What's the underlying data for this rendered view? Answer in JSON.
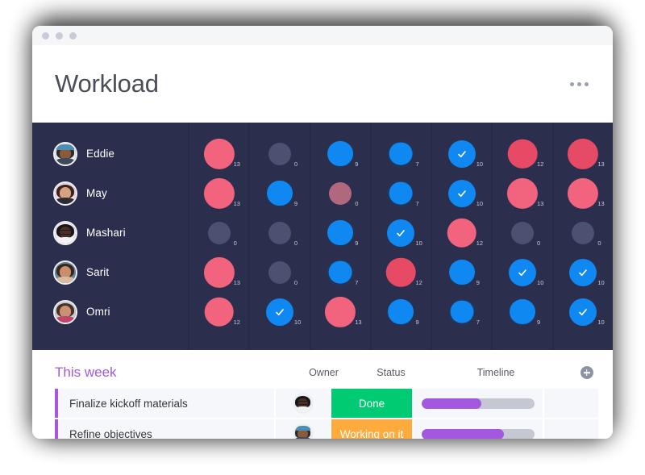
{
  "window": {
    "chrome_dots": [
      "dot-1",
      "dot-2",
      "dot-3"
    ],
    "title": "Workload",
    "menu_icon": "kebab-menu-icon"
  },
  "colors": {
    "grid_bg": "#2b2e4d",
    "grid_divider": "#272a47",
    "pink": "#f2637e",
    "red": "#e64a64",
    "mauve": "#b0687f",
    "blue": "#0f88f2",
    "blue_halo": "#243456",
    "gray": "#4d5070",
    "accent_purple": "#a358df",
    "done_green": "#00ca72",
    "working_orange": "#fdab3d",
    "track_gray": "#c5c8d3"
  },
  "workload": {
    "people": [
      {
        "name": "Eddie",
        "avatar": "avatar-eddie"
      },
      {
        "name": "May",
        "avatar": "avatar-may"
      },
      {
        "name": "Mashari",
        "avatar": "avatar-mashari"
      },
      {
        "name": "Sarit",
        "avatar": "avatar-sarit"
      },
      {
        "name": "Omri",
        "avatar": "avatar-omri"
      }
    ],
    "columns": [
      {
        "cells": [
          {
            "value": 13,
            "kind": "pink",
            "check": false
          },
          {
            "value": 13,
            "kind": "pink",
            "check": false
          },
          {
            "value": 0,
            "kind": "gray",
            "check": false
          },
          {
            "value": 13,
            "kind": "pink",
            "check": false
          },
          {
            "value": 12,
            "kind": "pink",
            "check": false
          }
        ]
      },
      {
        "cells": [
          {
            "value": 0,
            "kind": "gray",
            "check": false
          },
          {
            "value": 9,
            "kind": "blue",
            "check": false
          },
          {
            "value": 0,
            "kind": "gray",
            "check": false
          },
          {
            "value": 0,
            "kind": "gray",
            "check": false
          },
          {
            "value": 10,
            "kind": "blue",
            "check": true
          }
        ]
      },
      {
        "cells": [
          {
            "value": 9,
            "kind": "blue",
            "check": false
          },
          {
            "value": 0,
            "kind": "mauve",
            "check": false
          },
          {
            "value": 9,
            "kind": "blue",
            "check": false
          },
          {
            "value": 7,
            "kind": "blue",
            "check": false
          },
          {
            "value": 13,
            "kind": "pink",
            "check": false
          }
        ]
      },
      {
        "cells": [
          {
            "value": 7,
            "kind": "blue",
            "check": false
          },
          {
            "value": 7,
            "kind": "blue",
            "check": false
          },
          {
            "value": 10,
            "kind": "blue",
            "check": true
          },
          {
            "value": 12,
            "kind": "red",
            "check": false
          },
          {
            "value": 9,
            "kind": "blue",
            "check": false
          }
        ]
      },
      {
        "cells": [
          {
            "value": 10,
            "kind": "blue",
            "check": true
          },
          {
            "value": 10,
            "kind": "blue",
            "check": true
          },
          {
            "value": 12,
            "kind": "pink",
            "check": false
          },
          {
            "value": 9,
            "kind": "blue",
            "check": false
          },
          {
            "value": 7,
            "kind": "blue",
            "check": false
          }
        ]
      },
      {
        "cells": [
          {
            "value": 12,
            "kind": "red",
            "check": false
          },
          {
            "value": 13,
            "kind": "pink",
            "check": false
          },
          {
            "value": 0,
            "kind": "gray",
            "check": false
          },
          {
            "value": 10,
            "kind": "blue",
            "check": true
          },
          {
            "value": 9,
            "kind": "blue",
            "check": false
          }
        ]
      },
      {
        "cells": [
          {
            "value": 13,
            "kind": "red",
            "check": false
          },
          {
            "value": 13,
            "kind": "pink",
            "check": false
          },
          {
            "value": 0,
            "kind": "gray",
            "check": false
          },
          {
            "value": 10,
            "kind": "blue",
            "check": true
          },
          {
            "value": 10,
            "kind": "blue",
            "check": true
          }
        ]
      }
    ]
  },
  "board": {
    "group_title": "This week",
    "headers": {
      "owner": "Owner",
      "status": "Status",
      "timeline": "Timeline",
      "add": "add-column-icon"
    },
    "rows": [
      {
        "name": "Finalize kickoff materials",
        "owner_avatar": "avatar-mashari",
        "status": "Done",
        "status_color": "#00ca72",
        "progress": 53
      },
      {
        "name": "Refine objectives",
        "owner_avatar": "avatar-eddie",
        "status": "Working on it",
        "status_color": "#fdab3d",
        "progress": 73
      }
    ]
  }
}
